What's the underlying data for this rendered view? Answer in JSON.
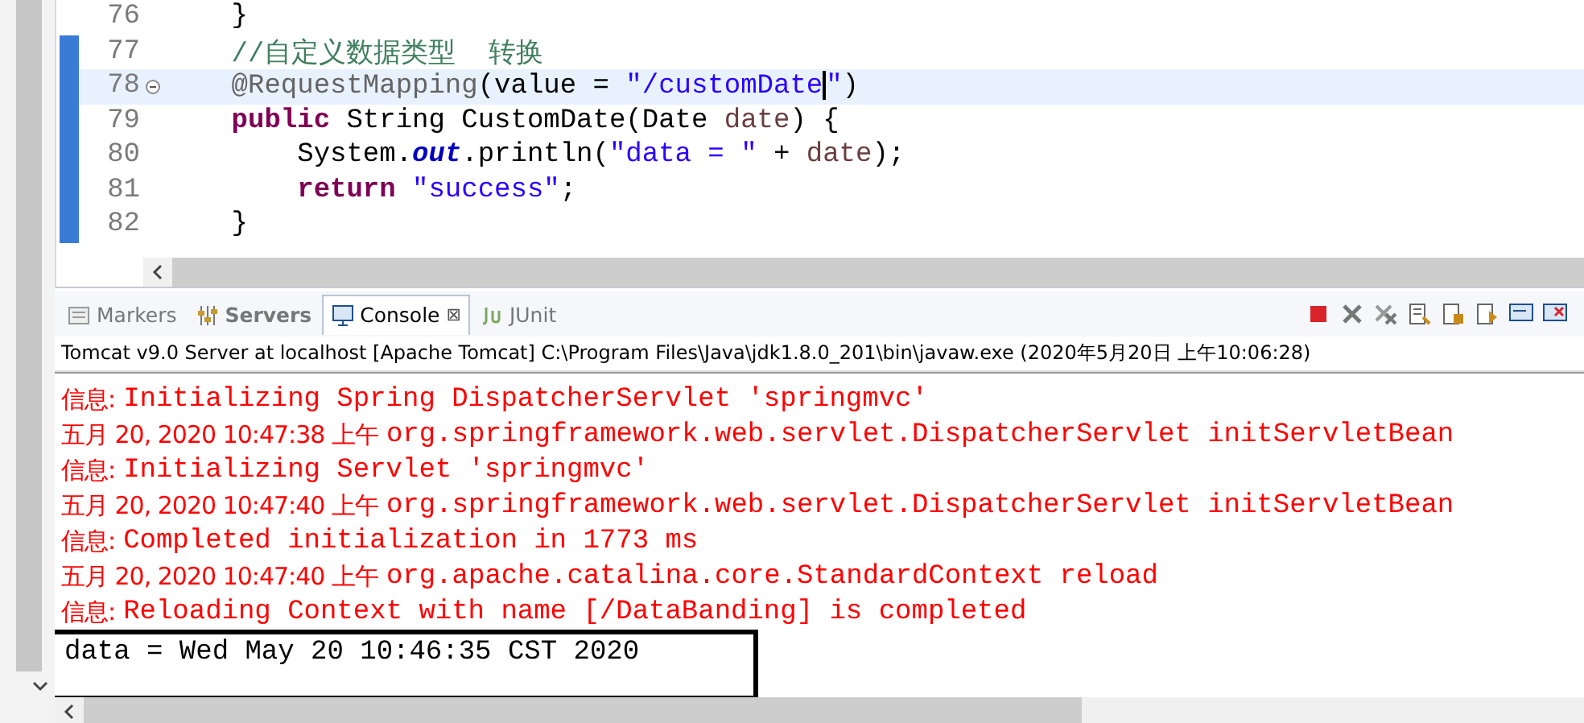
{
  "editor": {
    "lines": [
      {
        "number": "76",
        "highlighted": false,
        "fold": false,
        "tokens": [
          {
            "text": "    }",
            "kind": "plain"
          }
        ]
      },
      {
        "number": "77",
        "highlighted": false,
        "fold": false,
        "tokens": [
          {
            "text": "    //自定义数据类型  转换",
            "kind": "comment"
          }
        ]
      },
      {
        "number": "78",
        "highlighted": true,
        "fold": true,
        "tokens": [
          {
            "text": "    @RequestMapping",
            "kind": "annotation"
          },
          {
            "text": "(value = ",
            "kind": "plain"
          },
          {
            "text": "\"/customDate",
            "kind": "string",
            "caret": true
          },
          {
            "text": "\"",
            "kind": "string"
          },
          {
            "text": ")",
            "kind": "plain"
          }
        ]
      },
      {
        "number": "79",
        "highlighted": false,
        "fold": false,
        "tokens": [
          {
            "text": "    public",
            "kind": "keyword"
          },
          {
            "text": " String CustomDate(Date ",
            "kind": "plain"
          },
          {
            "text": "date",
            "kind": "variable"
          },
          {
            "text": ") {",
            "kind": "plain"
          }
        ]
      },
      {
        "number": "80",
        "highlighted": false,
        "fold": false,
        "tokens": [
          {
            "text": "        System.",
            "kind": "plain"
          },
          {
            "text": "out",
            "kind": "field"
          },
          {
            "text": ".println(",
            "kind": "plain"
          },
          {
            "text": "\"data = \"",
            "kind": "string"
          },
          {
            "text": " + ",
            "kind": "plain"
          },
          {
            "text": "date",
            "kind": "variable"
          },
          {
            "text": ");",
            "kind": "plain"
          }
        ]
      },
      {
        "number": "81",
        "highlighted": false,
        "fold": false,
        "tokens": [
          {
            "text": "        return",
            "kind": "keyword"
          },
          {
            "text": " \"success\"",
            "kind": "string"
          },
          {
            "text": ";",
            "kind": "plain"
          }
        ]
      },
      {
        "number": "82",
        "highlighted": false,
        "fold": false,
        "tokens": [
          {
            "text": "    }",
            "kind": "plain"
          }
        ]
      }
    ]
  },
  "views": {
    "tabs": [
      {
        "label": "Markers",
        "kind": "markers",
        "selected": false
      },
      {
        "label": "Servers",
        "kind": "servers",
        "selected": false
      },
      {
        "label": "Console",
        "kind": "console",
        "selected": true,
        "close": "⊠"
      },
      {
        "label": "JUnit",
        "kind": "junit",
        "selected": false
      }
    ]
  },
  "console": {
    "header": "Tomcat v9.0 Server at localhost [Apache Tomcat] C:\\Program Files\\Java\\jdk1.8.0_201\\bin\\javaw.exe (2020年5月20日 上午10:06:28)",
    "lines": [
      {
        "kind": "stderr",
        "prefix": "信息:",
        "text": "Initializing Spring DispatcherServlet 'springmvc'",
        "boxed": false
      },
      {
        "kind": "stderr",
        "prefix": "五月 20, 2020 10:47:38 上午",
        "text": "org.springframework.web.servlet.DispatcherServlet initServletBean",
        "boxed": false
      },
      {
        "kind": "stderr",
        "prefix": "信息:",
        "text": "Initializing Servlet 'springmvc'",
        "boxed": false
      },
      {
        "kind": "stderr",
        "prefix": "五月 20, 2020 10:47:40 上午",
        "text": "org.springframework.web.servlet.DispatcherServlet initServletBean",
        "boxed": false
      },
      {
        "kind": "stderr",
        "prefix": "信息:",
        "text": "Completed initialization in 1773 ms",
        "boxed": false
      },
      {
        "kind": "stderr",
        "prefix": "五月 20, 2020 10:47:40 上午",
        "text": "org.apache.catalina.core.StandardContext reload",
        "boxed": false
      },
      {
        "kind": "stderr",
        "prefix": "信息:",
        "text": "Reloading Context with name [/DataBanding] is completed",
        "boxed": false
      },
      {
        "kind": "stdout",
        "text": "data = Wed May 20 10:46:35 CST 2020",
        "boxed": true
      }
    ]
  }
}
